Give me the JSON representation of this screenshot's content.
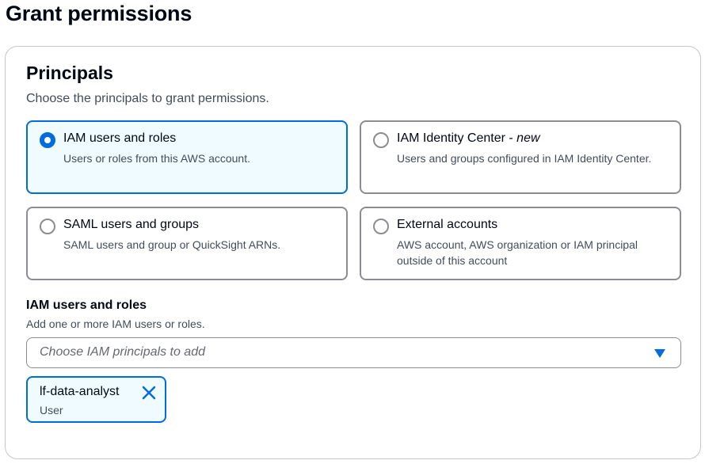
{
  "page": {
    "title": "Grant permissions"
  },
  "principals": {
    "title": "Principals",
    "description": "Choose the principals to grant permissions.",
    "options": [
      {
        "label": "IAM users and roles",
        "label_suffix": "",
        "description": "Users or roles from this AWS account.",
        "selected": true
      },
      {
        "label": "IAM Identity Center - ",
        "label_suffix": "new",
        "description": "Users and groups configured in IAM Identity Center.",
        "selected": false
      },
      {
        "label": "SAML users and groups",
        "label_suffix": "",
        "description": "SAML users and group or QuickSight ARNs.",
        "selected": false
      },
      {
        "label": "External accounts",
        "label_suffix": "",
        "description": "AWS account, AWS organization or IAM principal outside of this account",
        "selected": false
      }
    ]
  },
  "iam_field": {
    "label": "IAM users and roles",
    "description": "Add one or more IAM users or roles.",
    "placeholder": "Choose IAM principals to add",
    "tokens": [
      {
        "name": "lf-data-analyst",
        "type": "User"
      }
    ]
  },
  "icons": {
    "dropdown": "caret-down-icon",
    "token_dismiss": "close-icon"
  },
  "colors": {
    "accent": "#006ce0",
    "selected_bg": "#f0fbff",
    "border": "#8c8c94",
    "text": "#000716",
    "secondary_text": "#414d5c"
  }
}
